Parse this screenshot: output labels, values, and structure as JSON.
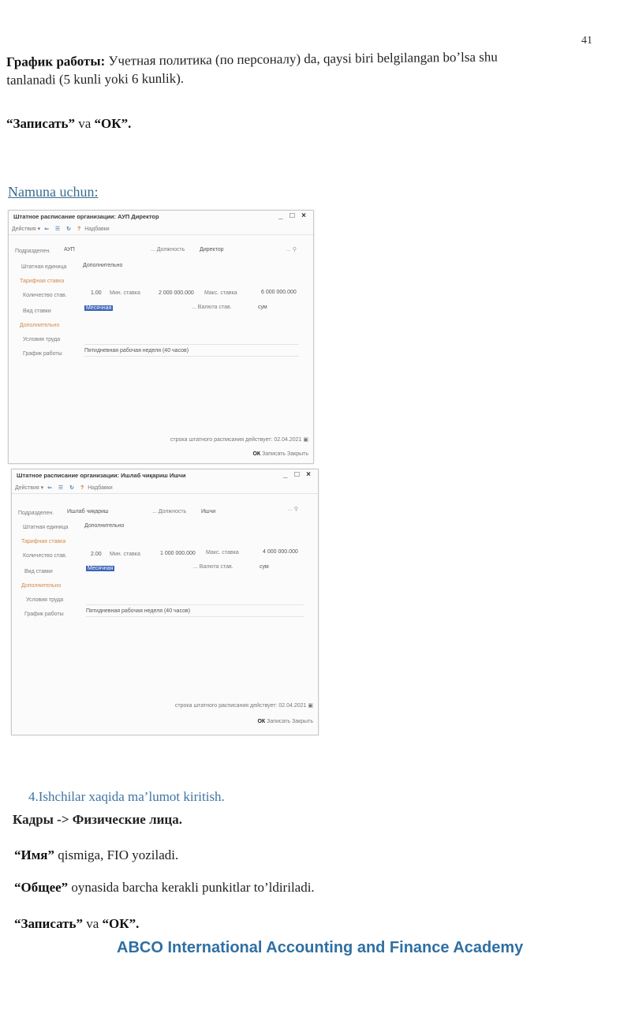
{
  "page_number": "41",
  "para1": {
    "bold": "График работы:",
    "rest": " Учетная политика (по персоналу) da, qaysi biri belgilangan bo’lsa shu",
    "line2": "tanlanadi (5 kunli yoki 6 kunlik)."
  },
  "para2": {
    "bold1": "“Записать”",
    "mid": " va ",
    "bold2": "“ОК”."
  },
  "namuna": "Namuna uchun:",
  "windows": [
    {
      "title": "Штатное расписание организации: АУП Директор",
      "controls": "_ □ ×",
      "toolbar": {
        "actions": "Действия ▾",
        "settings": "Надбавки"
      },
      "podrazdelenie_label": "Подразделен.",
      "podrazdelenie_value": "АУП",
      "dolzhnost_label": "... Должность",
      "dolzhnost_value": "Директор",
      "shtat_label": "Штатная единица",
      "shtat_value": "Дополнительно",
      "tarif_header": "Тарифная ставка",
      "kolvo_label": "Количество став.",
      "kolvo_value": "1.00",
      "min_label": "Мин. ставка",
      "min_value": "2 000 000.000",
      "max_label": "Макс. ставка",
      "max_value": "6 000 000.000",
      "vid_label": "Вид ставки",
      "vid_value": "Месячная",
      "valuta_label": "... Валюта став.",
      "valuta_value": "сум",
      "dop_header": "Дополнительно",
      "usloviya_label": "Условия труда",
      "grafik_label": "График работы",
      "grafik_value": "Пятидневная рабочая неделя (40 часов)",
      "stroka_label": "строка штатного расписания действует:",
      "stroka_date": "02.04.2021",
      "ok": "ОК",
      "save": "Записать",
      "close": "Закрыть"
    },
    {
      "title": "Штатное расписание организации: Ишлаб чиқариш Ишчи",
      "controls": "_ □ ×",
      "toolbar": {
        "actions": "Действия ▾",
        "settings": "Надбавки"
      },
      "podrazdelenie_label": "Подразделен.",
      "podrazdelenie_value": "Ишлаб чиқариш",
      "dolzhnost_label": "... Должность",
      "dolzhnost_value": "Ишчи",
      "shtat_label": "Штатная единица",
      "shtat_value": "Дополнительно",
      "tarif_header": "Тарифная ставка",
      "kolvo_label": "Количество став.",
      "kolvo_value": "2.00",
      "min_label": "Мин. ставка",
      "min_value": "1 000 000.000",
      "max_label": "Макс. ставка",
      "max_value": "4 000 000.000",
      "vid_label": "Вид ставки",
      "vid_value": "Месячная",
      "valuta_label": "... Валюта став.",
      "valuta_value": "сум",
      "dop_header": "Дополнительно",
      "usloviya_label": "Условия труда",
      "grafik_label": "График работы",
      "grafik_value": "Пятидневная рабочая неделя (40 часов)",
      "stroka_label": "строка штатного расписания действует:",
      "stroka_date": "02.04.2021",
      "ok": "ОК",
      "save": "Записать",
      "close": "Закрыть"
    }
  ],
  "section_title": "4.Ishchilar xaqida ma’lumot kiritish.",
  "para3": "Кадры -> Физические лица.",
  "para4": {
    "bold": "“Имя”",
    "rest": " qismiga, FIO yoziladi."
  },
  "para5": {
    "bold": "“Общее”",
    "rest": " oynasida barcha kerakli punkitlar to’ldiriladi."
  },
  "para6": {
    "bold1": "“Записать”",
    "mid": " va ",
    "bold2": "“ОК”."
  },
  "footer": "ABCO International Accounting and Finance Academy"
}
